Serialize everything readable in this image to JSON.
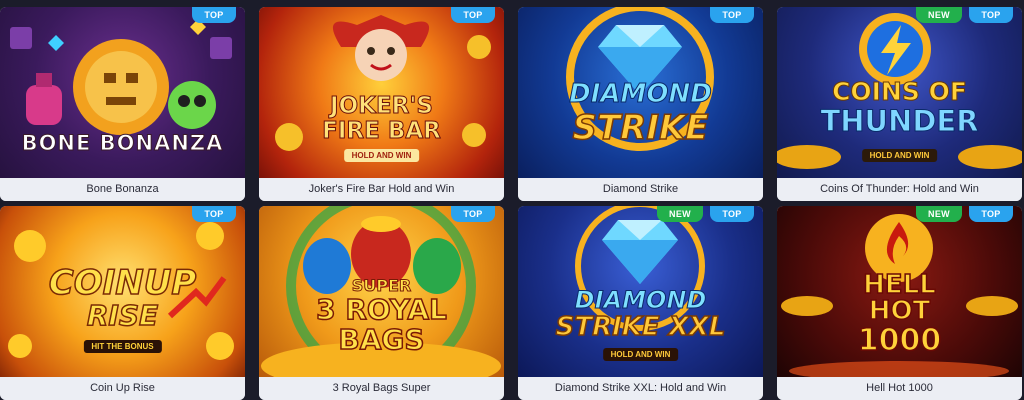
{
  "badges": {
    "top": "TOP",
    "new": "NEW"
  },
  "games": [
    {
      "name": "Bone Bonanza",
      "art_title_1": "BONE BONANZA",
      "badges": [
        "TOP"
      ]
    },
    {
      "name": "Joker's Fire Bar Hold and Win",
      "art_title_1": "JOKER'S",
      "art_title_2": "FIRE BAR",
      "art_sub": "HOLD AND WIN",
      "badges": [
        "TOP"
      ]
    },
    {
      "name": "Diamond Strike",
      "art_title_1": "DIAMOND",
      "art_title_2": "STRIKE",
      "badges": [
        "TOP"
      ]
    },
    {
      "name": "Coins Of Thunder: Hold and Win",
      "art_title_1": "COINS OF",
      "art_title_2": "THUNDER",
      "art_sub": "HOLD AND WIN",
      "badges": [
        "NEW",
        "TOP"
      ]
    },
    {
      "name": "Coin Up Rise",
      "art_title_1": "COINUP",
      "art_title_2": "RISE",
      "art_sub": "HIT THE BONUS",
      "badges": [
        "TOP"
      ]
    },
    {
      "name": "3 Royal Bags Super",
      "art_title_0": "SUPER",
      "art_title_1": "3 ROYAL",
      "art_title_2": "BAGS",
      "badges": [
        "TOP"
      ]
    },
    {
      "name": "Diamond Strike XXL: Hold and Win",
      "art_title_1": "DIAMOND",
      "art_title_2": "STRIKE XXL",
      "art_sub": "HOLD AND WIN",
      "badges": [
        "NEW",
        "TOP"
      ]
    },
    {
      "name": "Hell Hot 1000",
      "art_title_1": "HELL",
      "art_title_2": "HOT",
      "art_title_3": "1000",
      "badges": [
        "NEW",
        "TOP"
      ]
    }
  ]
}
